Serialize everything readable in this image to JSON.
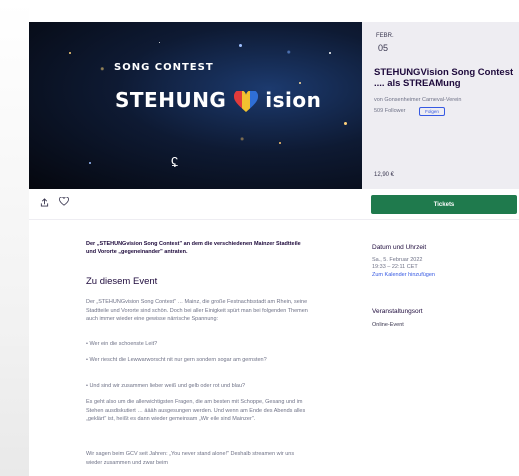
{
  "colors": {
    "accent": "#3659e3",
    "tickets_bg": "#1f7a4d",
    "sidebar_bg": "#eeedf2"
  },
  "hero": {
    "logo_left": "STEHUNG",
    "logo_right": "ision",
    "logo_sub": "SONG CONTEST",
    "logo_mark": "ʢ"
  },
  "sidebar": {
    "month": "FEBR.",
    "day": "05",
    "title": "STEHUNGVision Song Contest .... als STREAMung",
    "organizer": "von Gonsenheimer Carneval-Verein",
    "followers": "509 Follower",
    "follow_label": "Folgen",
    "price": "12,90 €"
  },
  "actionbar": {
    "share_icon": "share-icon",
    "like_icon": "heart-icon",
    "tickets_label": "Tickets"
  },
  "main": {
    "summary": "Der „STEHUNGvision Song Contest\" an dem die verschiedenen Mainzer Stadtteile und Vororte „gegeneinander\" antraten.",
    "about_heading": "Zu diesem Event",
    "paragraphs": [
      "Der „STEHUNGvision Song Contest\" … Mainz, die große Festnachtsstadt am Rhein, seine Stadtteile und Vororte sind schön. Doch bei aller Einigkeit spürt man bei folgenden Themen auch immer wieder eine gewisse närrische Spannung:",
      "• Wer ein die schoenste Leit?",
      "• Wer riescht die Lewwarworscht nit nur gern sondern sogar am gernsten?",
      "• Und sind wir zusammen lieber weiß und gelb oder rot und blau?",
      "Es geht also um die allerwichtigsten Fragen, die am besten mit Schoppe, Gesang und im Stehen ausdiskutiert … äääh ausgesungen werden. Und wenn am Ende des Abends alles „geklärt\" ist, heißt es dann wieder gemeinsam „Wir eile sind Mainzer\".",
      "Wir sagen beim GCV seit Jahren: „You never stand alone!\" Deshalb streamen wir uns wieder zusammen und zwar beim"
    ],
    "para_bold": "„You never stand alone!\""
  },
  "details": {
    "date_heading": "Datum und Uhrzeit",
    "date_line1": "Sa., 5. Februar 2022",
    "date_line2": "19:33 – 22:11 CET",
    "calendar_link": "Zum Kalender hinzufügen",
    "location_heading": "Veranstaltungsort",
    "location_value": "Online-Event"
  }
}
